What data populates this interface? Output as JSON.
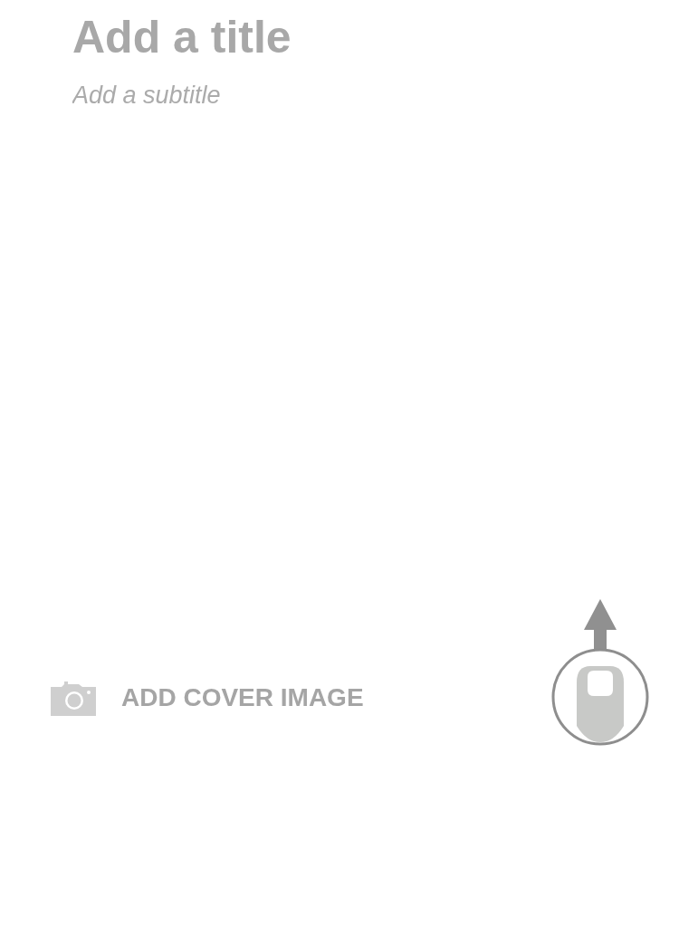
{
  "title": {
    "placeholder": "Add a title"
  },
  "subtitle": {
    "placeholder": "Add a subtitle"
  },
  "cover_button": {
    "label": "ADD COVER IMAGE"
  }
}
